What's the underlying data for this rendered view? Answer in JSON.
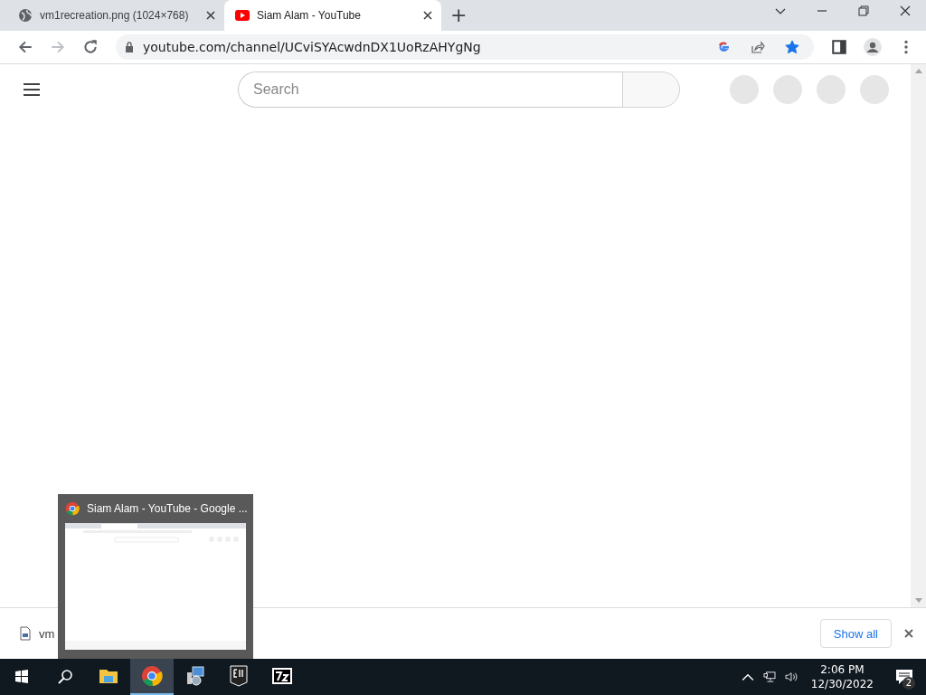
{
  "tabs": [
    {
      "title": "vm1recreation.png (1024×768)",
      "kind": "site",
      "selected": false
    },
    {
      "title": "Siam Alam - YouTube",
      "kind": "video",
      "selected": true
    }
  ],
  "new_tab": "+",
  "address_bar": {
    "url": "youtube.com/channel/UCviSYAcwdnDX1UoRzAHYgNg",
    "bookmarked": true
  },
  "page": {
    "search": {
      "placeholder": "Search"
    }
  },
  "download_bar": {
    "file": "vm",
    "button": "Show all"
  },
  "taskbar_preview": {
    "title": "Siam Alam - YouTube - Google ..."
  },
  "taskbar": {
    "apps": [
      {
        "kind": "explorer",
        "active": false
      },
      {
        "kind": "chrome",
        "active": true
      },
      {
        "kind": "installer",
        "active": false
      },
      {
        "kind": "epic",
        "active": false
      },
      {
        "kind": "sevenzip",
        "active": false
      }
    ],
    "time": "2:06 PM",
    "date": "12/30/2022",
    "notifications": "2"
  }
}
